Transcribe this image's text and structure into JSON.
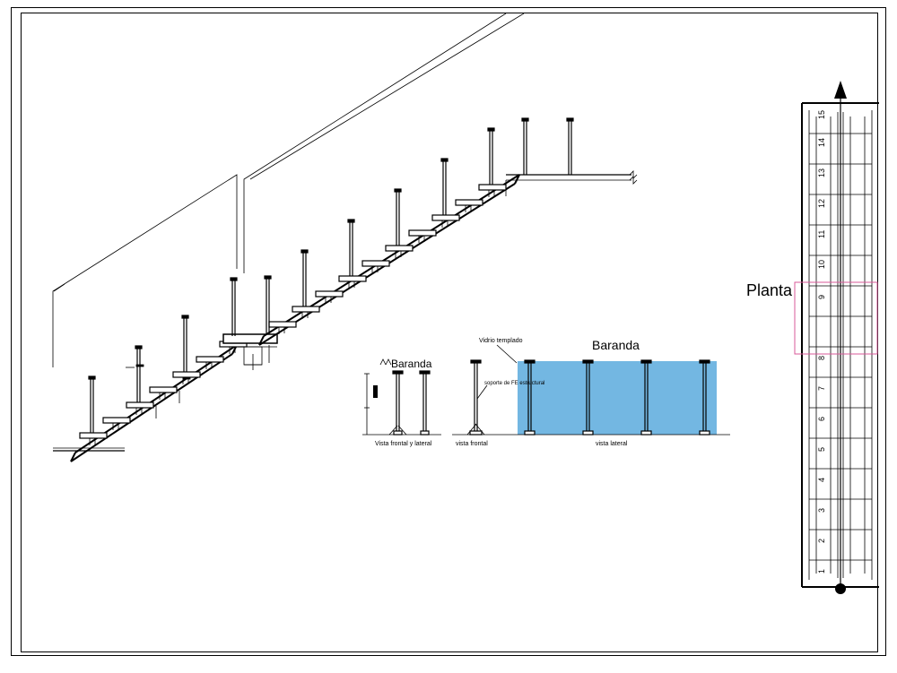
{
  "drawing": {
    "title_plan": "Planta",
    "railing": {
      "label": "Baranda",
      "view_side": "Vista frontal y lateral",
      "view_frontal": "vista frontal",
      "view_lateral": "vista lateral",
      "glass_note": "Vidrio templado",
      "post_note": "soporte de FE estructural"
    },
    "plan": {
      "step_numbers": [
        "1",
        "2",
        "3",
        "4",
        "5",
        "6",
        "7",
        "8",
        "9",
        "10",
        "11",
        "12",
        "13",
        "14",
        "15"
      ]
    },
    "colors": {
      "glass": "#6cb3e0",
      "highlight": "#d85a9a"
    }
  }
}
